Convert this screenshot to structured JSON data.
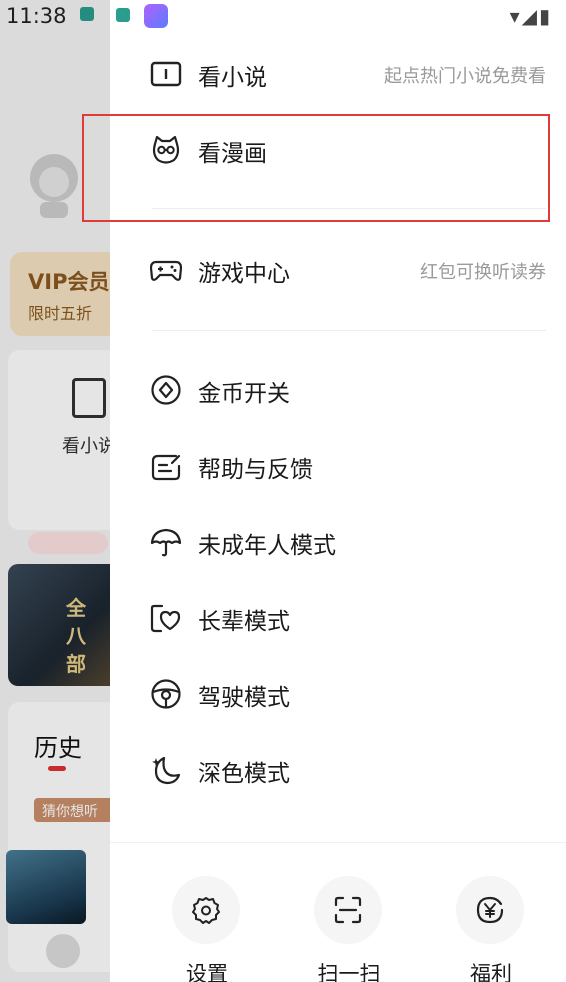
{
  "status_bar": {
    "time": "11:38",
    "signal": "▾◢▮"
  },
  "background": {
    "vip_title": "VIP会员",
    "vip_sub": "限时五折",
    "card_label": "看小说",
    "cover_chars": [
      "全",
      "八",
      "部"
    ],
    "history_title": "历史",
    "guess_tag": "猜你想听"
  },
  "menu": {
    "items": [
      {
        "label": "看小说",
        "sub": "起点热门小说免费看",
        "icon": "book-icon"
      },
      {
        "label": "看漫画",
        "sub": "",
        "icon": "cat-face-icon"
      },
      {
        "label": "游戏中心",
        "sub": "红包可换听读券",
        "icon": "gamepad-icon"
      },
      {
        "label": "金币开关",
        "sub": "",
        "icon": "coin-icon"
      },
      {
        "label": "帮助与反馈",
        "sub": "",
        "icon": "feedback-icon"
      },
      {
        "label": "未成年人模式",
        "sub": "",
        "icon": "umbrella-icon"
      },
      {
        "label": "长辈模式",
        "sub": "",
        "icon": "heart-frame-icon"
      },
      {
        "label": "驾驶模式",
        "sub": "",
        "icon": "steering-wheel-icon"
      },
      {
        "label": "深色模式",
        "sub": "",
        "icon": "moon-icon"
      }
    ]
  },
  "bottom_bar": {
    "settings": "设置",
    "scan": "扫一扫",
    "welfare": "福利"
  },
  "highlight_color": "#e03a3a"
}
